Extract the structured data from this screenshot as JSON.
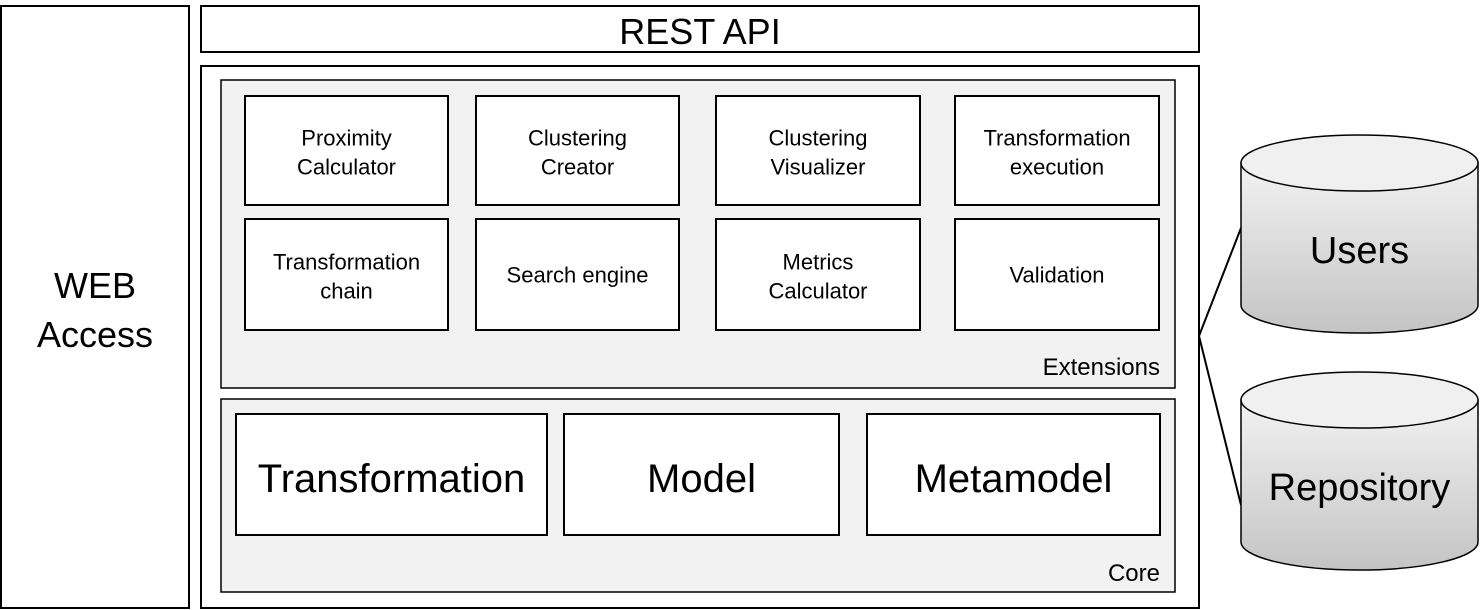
{
  "web_access": {
    "line1": "WEB",
    "line2": "Access"
  },
  "rest_api": "REST API",
  "extensions": {
    "label": "Extensions",
    "modules": [
      {
        "line1": "Proximity",
        "line2": "Calculator"
      },
      {
        "line1": "Clustering",
        "line2": "Creator"
      },
      {
        "line1": "Clustering",
        "line2": "Visualizer"
      },
      {
        "line1": "Transformation",
        "line2": "execution"
      },
      {
        "line1": "Transformation",
        "line2": "chain"
      },
      {
        "line1": "Search engine",
        "line2": ""
      },
      {
        "line1": "Metrics",
        "line2": "Calculator"
      },
      {
        "line1": "Validation",
        "line2": ""
      }
    ]
  },
  "core": {
    "label": "Core",
    "modules": [
      "Transformation",
      "Model",
      "Metamodel"
    ]
  },
  "databases": [
    "Users",
    "Repository"
  ],
  "colors": {
    "panel": "#f2f2f2",
    "db_light": "#f2f2f2",
    "db_dark": "#c4c4c4"
  }
}
